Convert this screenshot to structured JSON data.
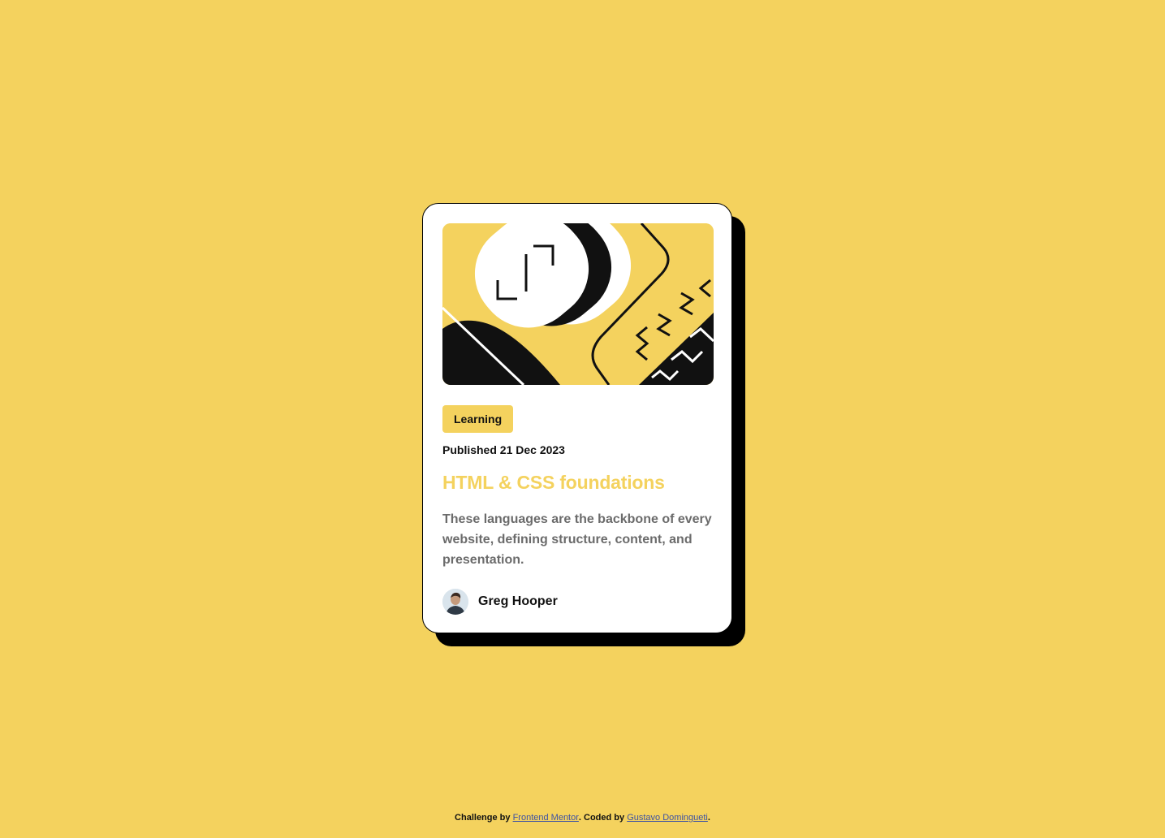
{
  "colors": {
    "background": "#f4d25e",
    "card": "#ffffff",
    "shadow": "#000000",
    "accent": "#f4d25e",
    "muted_text": "#6b6b6b",
    "link": "#3e52a3"
  },
  "card": {
    "image": "illustration-article",
    "tag": "Learning",
    "published": "Published 21 Dec 2023",
    "title": "HTML & CSS foundations",
    "description": "These languages are the backbone of every website, defining structure, content, and presentation.",
    "author": {
      "avatar": "avatar-image",
      "name": "Greg Hooper"
    }
  },
  "footer": {
    "challenge_prefix": "Challenge by",
    "challenge_link": "Frontend Mentor",
    "coded_prefix": ". Coded by",
    "coded_link": "Gustavo Domingueti",
    "suffix": "."
  }
}
